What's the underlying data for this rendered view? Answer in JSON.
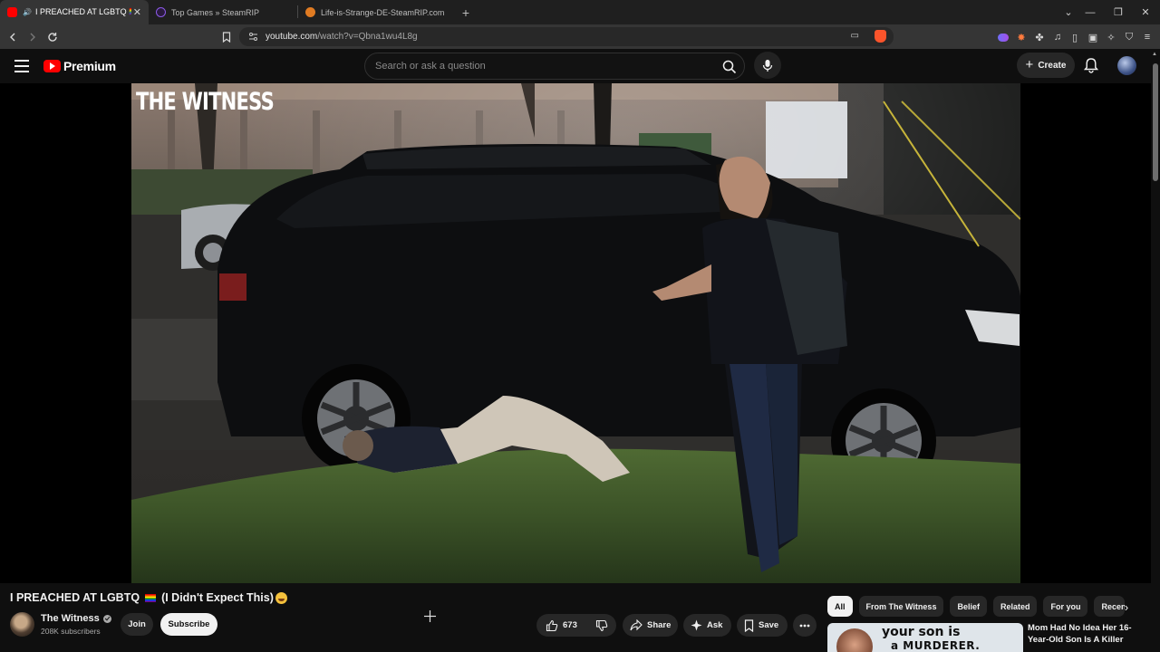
{
  "browser": {
    "tabs": [
      {
        "title": "I PREACHED AT LGBTQ 🏳️‍🌈 (I D",
        "favicon_color": "#ff0000",
        "active": true
      },
      {
        "title": "Top Games » SteamRIP",
        "favicon_color": "#7b3fe4",
        "active": false
      },
      {
        "title": "Life-is-Strange-DE-SteamRIP.com.rar",
        "favicon_color": "#e07b22",
        "active": false
      }
    ],
    "url_host": "youtube.com",
    "url_path": "/watch?v=Qbna1wu4L8g"
  },
  "masthead": {
    "logo_text": "Premium",
    "search_placeholder": "Search or ask a question",
    "create_label": "Create"
  },
  "video": {
    "watermark": "THE WITNESS",
    "title": "I PREACHED AT LGBTQ",
    "title_suffix": "(I Didn't Expect This)"
  },
  "channel": {
    "name": "The Witness",
    "subscribers": "208K subscribers",
    "join_label": "Join",
    "subscribe_label": "Subscribe"
  },
  "actions": {
    "likes": "673",
    "share_label": "Share",
    "ask_label": "Ask",
    "save_label": "Save"
  },
  "chips": [
    "All",
    "From The Witness",
    "Belief",
    "Related",
    "For you",
    "Recen"
  ],
  "recommendation": {
    "thumb_text_1": "your son is",
    "thumb_text_2": "a MURDERER.",
    "title": "Mom Had No Idea Her 16-Year-Old Son Is A Killer"
  },
  "colors": {
    "accent_red": "#ff0000",
    "background": "#0f0f0f",
    "pill": "#272727"
  }
}
